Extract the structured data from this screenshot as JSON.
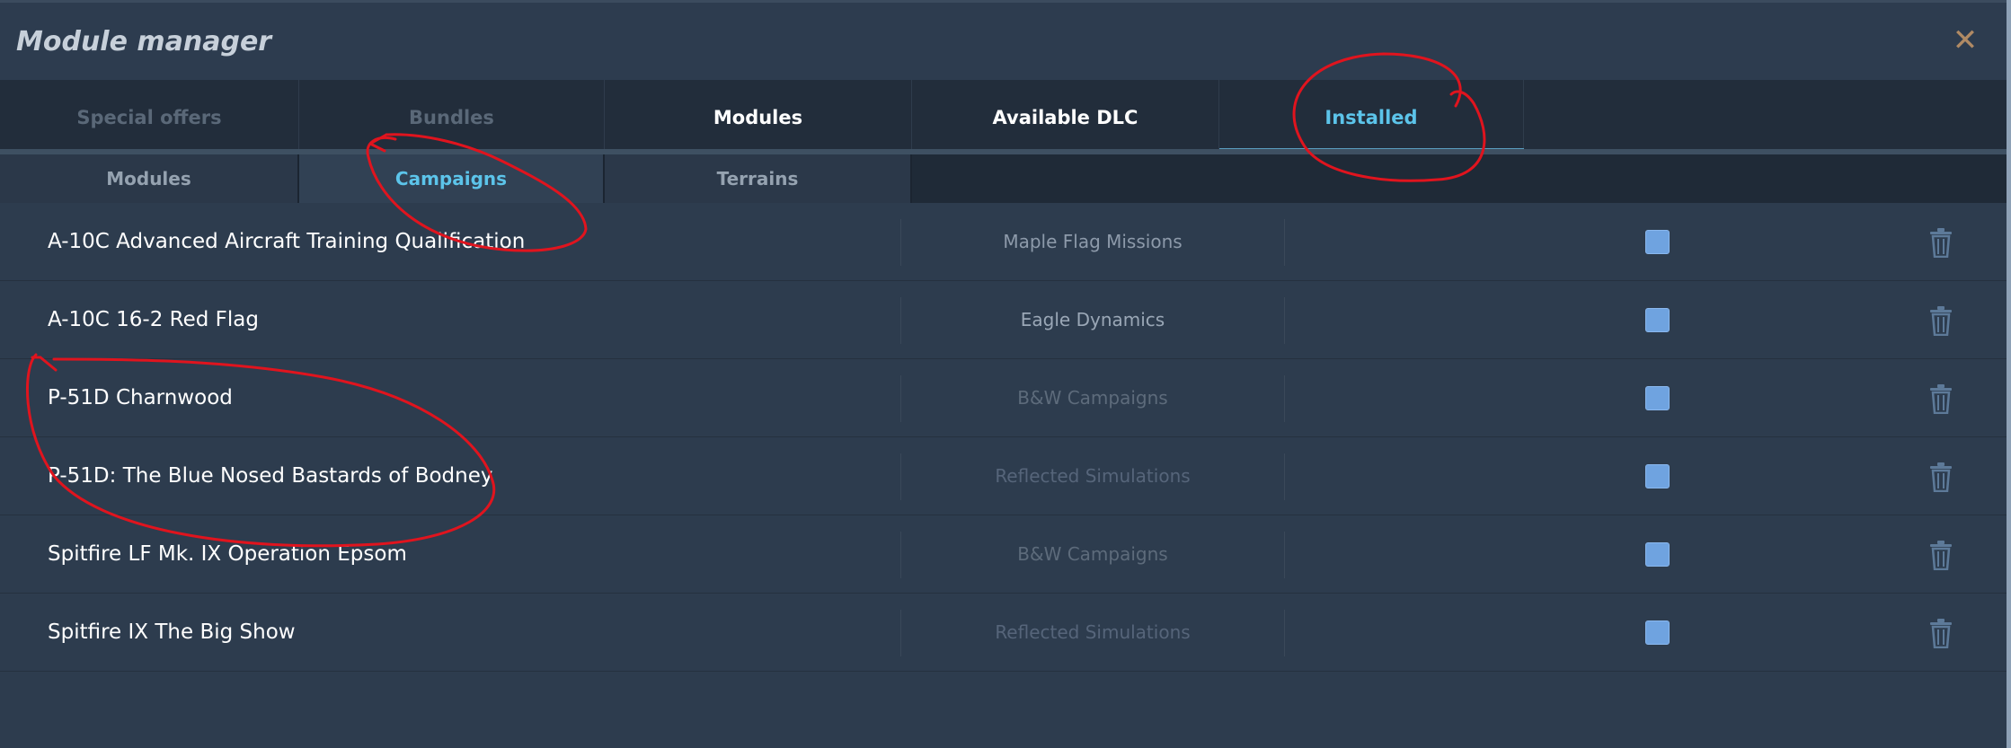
{
  "window": {
    "title": "Module manager",
    "close_symbol": "✕"
  },
  "top_tabs": [
    {
      "label": "Special offers",
      "state": "disabled"
    },
    {
      "label": "Bundles",
      "state": "disabled"
    },
    {
      "label": "Modules",
      "state": "normal"
    },
    {
      "label": "Available DLC",
      "state": "normal"
    },
    {
      "label": "Installed",
      "state": "active"
    }
  ],
  "sub_tabs": [
    {
      "label": "Modules",
      "state": "normal"
    },
    {
      "label": "Campaigns",
      "state": "active"
    },
    {
      "label": "Terrains",
      "state": "normal"
    }
  ],
  "campaigns": [
    {
      "name": "A-10C Advanced Aircraft Training Qualification",
      "author": "Maple Flag Missions",
      "author_color": "#8d9aaa",
      "enabled": true
    },
    {
      "name": "A-10C 16-2 Red Flag",
      "author": "Eagle Dynamics",
      "author_color": "#9aa7b6",
      "enabled": true
    },
    {
      "name": "P-51D Charnwood",
      "author": "B&W Campaigns",
      "author_color": "#5d6b7b",
      "enabled": true
    },
    {
      "name": "P-51D: The Blue Nosed Bastards of Bodney",
      "author": "Reflected Simulations",
      "author_color": "#56657a",
      "enabled": true
    },
    {
      "name": "Spitfire LF Mk. IX Operation Epsom",
      "author": "B&W Campaigns",
      "author_color": "#5d6b7b",
      "enabled": true
    },
    {
      "name": "Spitfire IX The Big Show",
      "author": "Reflected Simulations",
      "author_color": "#56657a",
      "enabled": true
    }
  ],
  "icons": {
    "close": "close-icon",
    "delete": "trash-icon",
    "checkbox": "checkbox"
  },
  "colors": {
    "accent": "#5cc4ea",
    "annotation": "#e0141e",
    "checkbox": "#6fa3e0"
  }
}
